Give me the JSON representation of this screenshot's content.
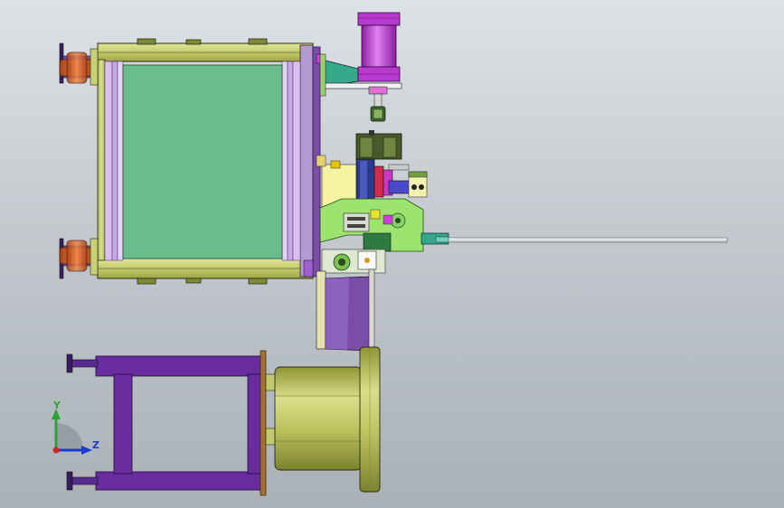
{
  "viewport": {
    "background_top": "#dde2e6",
    "background_bottom": "#a9b1b7"
  },
  "triad": {
    "y_label": "Y",
    "z_label": "Z",
    "y_color": "#2da23a",
    "z_color": "#1d3dc8",
    "x_color": "#d62020"
  },
  "model": {
    "parts": [
      "tank-frame",
      "tank-panel",
      "top-caster-wheel",
      "bottom-caster-wheel",
      "pneumatic-cylinder",
      "cylinder-bracket",
      "spray-nozzle",
      "valve-block",
      "mechanism-assembly",
      "extension-rod",
      "guide-plate",
      "motor-stand",
      "motor-housing",
      "motor-flange"
    ],
    "colors": {
      "frame": "#c8cf78",
      "panel": "#6dbf8f",
      "rail": "#d8b8f0",
      "cylinder": "#b93ad0",
      "wheel": "#d8662a",
      "mechanism": "#9de36f",
      "stand": "#6a2da1",
      "motor": "#b8bf5a",
      "yellow": "#f6f3a0",
      "olive": "#4a5a2a"
    }
  }
}
